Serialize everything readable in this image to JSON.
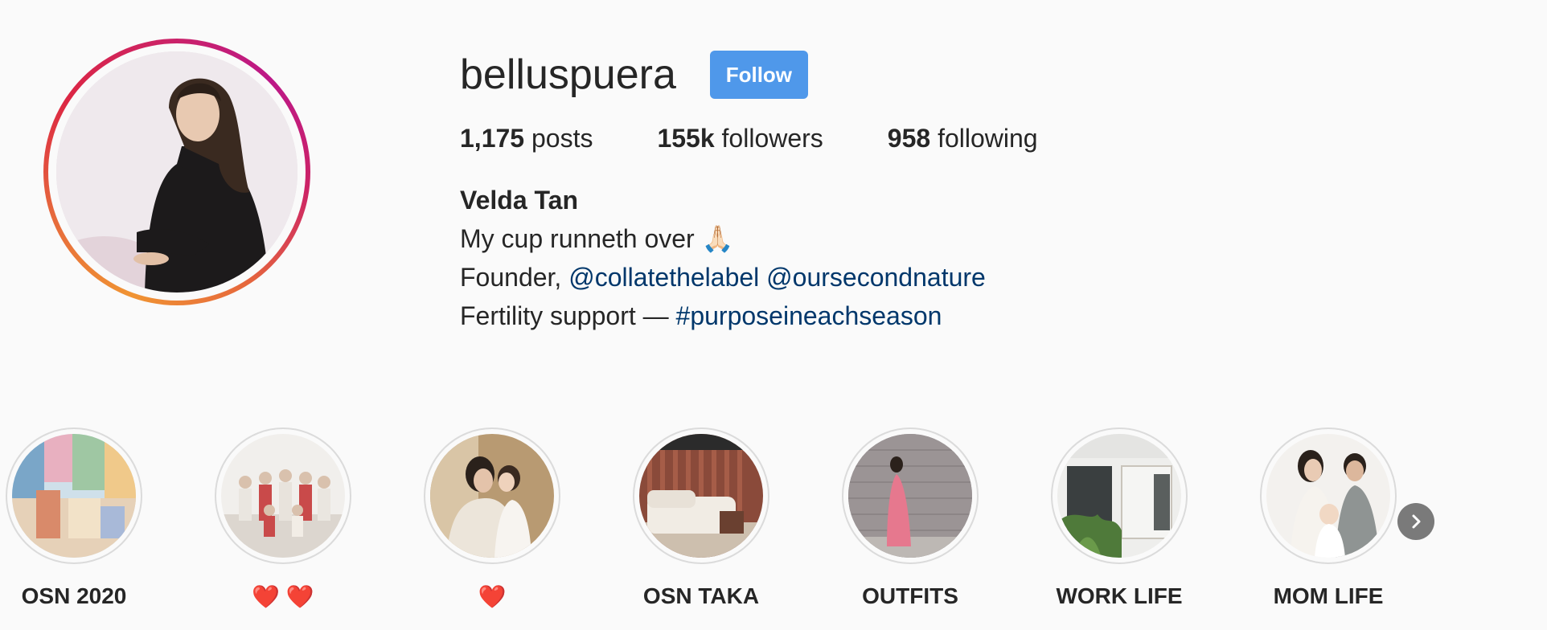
{
  "profile": {
    "username": "belluspuera",
    "follow_label": "Follow",
    "stats": [
      {
        "count": "1,175",
        "label": "posts"
      },
      {
        "count": "155k",
        "label": "followers"
      },
      {
        "count": "958",
        "label": "following"
      }
    ],
    "bio": {
      "name": "Velda Tan",
      "line1": "My cup runneth over 🙏🏻",
      "line2_prefix": "Founder, ",
      "line2_link1": "@collatethelabel",
      "line2_sep": " ",
      "line2_link2": "@oursecondnature",
      "line3_prefix": "Fertility support — ",
      "line3_link": "#purposeineachseason"
    }
  },
  "highlights": [
    {
      "label": "OSN 2020"
    },
    {
      "label": "❤️ ❤️"
    },
    {
      "label": "❤️"
    },
    {
      "label": "OSN TAKA"
    },
    {
      "label": "OUTFITS"
    },
    {
      "label": "WORK LIFE"
    },
    {
      "label": "MOM LIFE"
    }
  ],
  "colors": {
    "follow_button": "#4f98ea",
    "link": "#00376b",
    "text": "#262626",
    "background": "#fafafa"
  },
  "icons": {
    "next": "chevron-right-icon"
  }
}
